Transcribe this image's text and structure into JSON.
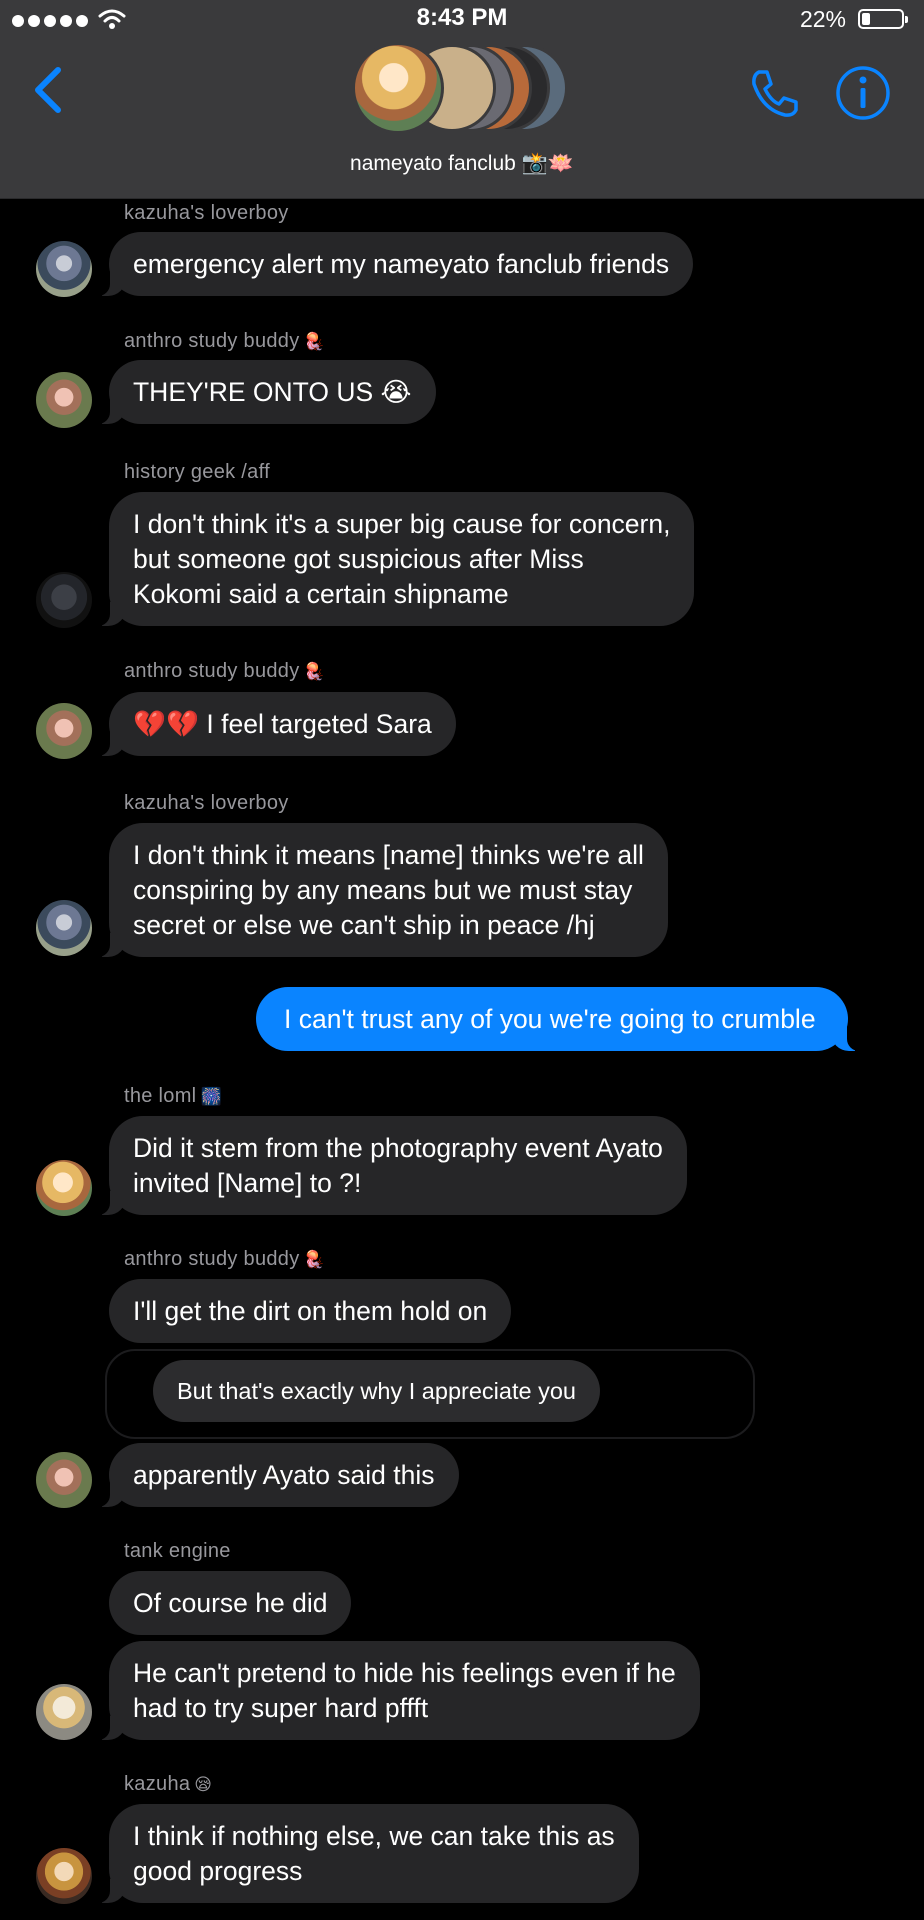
{
  "status_bar": {
    "time": "8:43 PM",
    "battery": "22%",
    "battery_level": 0.22
  },
  "header": {
    "group_name": "nameyato fanclub 📸🪷",
    "icons": [
      "back-chevron-icon",
      "phone-icon",
      "info-icon"
    ]
  },
  "colors": {
    "header_bg": "#3a3a3c",
    "incoming_bubble": "#262628",
    "outgoing_bubble": "#0a84ff",
    "accent": "#0a84ff",
    "sender_text": "#98989d"
  },
  "messages": [
    {
      "sender": "kazuha's loverboy",
      "text": "emergency alert my nameyato fanclub friends"
    },
    {
      "sender": "anthro study buddy",
      "sender_emoji": "🪼",
      "text": "THEY'RE ONTO US",
      "text_emoji": "😭"
    },
    {
      "sender": "history geek /aff",
      "lines": [
        "I don't think it's a super big cause for concern,",
        "but someone got suspicious after Miss",
        "Kokomi said a certain shipname"
      ]
    },
    {
      "sender": "anthro study buddy",
      "sender_emoji": "🪼",
      "text_emoji": "💔💔",
      "text": "I feel targeted Sara"
    },
    {
      "sender": "kazuha's loverboy",
      "lines": [
        "I don't think it means [name] thinks we're all",
        "conspiring by any means but we must stay",
        "secret or else we can't ship in peace /hj"
      ]
    },
    {
      "sender": "me",
      "text": "I can't trust any of you we're going to crumble"
    },
    {
      "sender": "the loml",
      "sender_emoji": "🎆",
      "lines": [
        "Did it stem from the photography event Ayato",
        "invited [Name] to ?!"
      ]
    },
    {
      "sender": "anthro study buddy",
      "sender_emoji": "🪼",
      "text": "I'll get the dirt on them hold on"
    },
    {
      "quote": "But that's exactly why I appreciate you"
    },
    {
      "text": "apparently Ayato said this"
    },
    {
      "sender": "tank engine",
      "text": "Of course he did"
    },
    {
      "lines": [
        "He can't pretend to hide his feelings even if he",
        "had to try super hard pffft"
      ]
    },
    {
      "sender": "kazuha",
      "sender_emoji": "😪",
      "lines": [
        "I think if nothing else, we can take this as",
        "good progress"
      ]
    }
  ]
}
